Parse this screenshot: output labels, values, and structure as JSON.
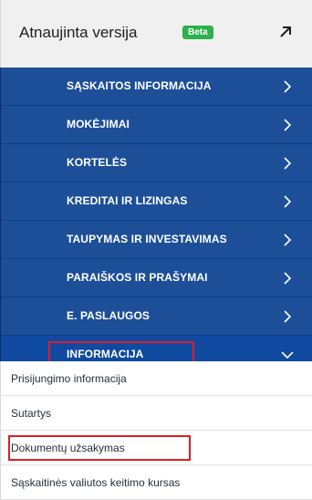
{
  "header": {
    "title": "Atnaujinta versija",
    "badge": "Beta",
    "action_icon": "arrow-up-right-icon"
  },
  "menu": {
    "items": [
      {
        "label": "SĄSKAITOS INFORMACIJA",
        "icon": "chevron-right-icon"
      },
      {
        "label": "MOKĖJIMAI",
        "icon": "chevron-right-icon"
      },
      {
        "label": "KORTELĖS",
        "icon": "chevron-right-icon"
      },
      {
        "label": "KREDITAI IR LIZINGAS",
        "icon": "chevron-right-icon"
      },
      {
        "label": "TAUPYMAS IR INVESTAVIMAS",
        "icon": "chevron-right-icon"
      },
      {
        "label": "PARAIŠKOS IR PRAŠYMAI",
        "icon": "chevron-right-icon"
      },
      {
        "label": "E. PASLAUGOS",
        "icon": "chevron-right-icon"
      },
      {
        "label": "INFORMACIJA",
        "icon": "chevron-down-icon",
        "expanded": true
      }
    ]
  },
  "submenu": {
    "items": [
      {
        "label": "Prisijungimo informacija"
      },
      {
        "label": "Sutartys"
      },
      {
        "label": "Dokumentų užsakymas"
      },
      {
        "label": "Sąskaitinės valiutos keitimo kursas"
      }
    ]
  },
  "colors": {
    "menu_bg": "#1d4f98",
    "active_bg": "#0f4aa0",
    "highlight": "#d81f2a",
    "beta_green": "#2bb24c"
  }
}
